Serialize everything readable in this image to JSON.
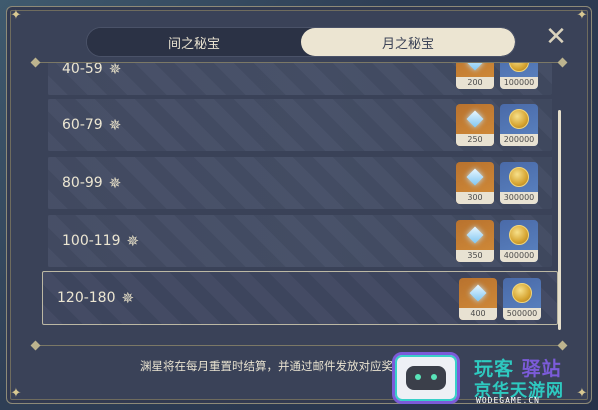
{
  "tabs": [
    {
      "label": "间之秘宝",
      "active": false
    },
    {
      "label": "月之秘宝",
      "active": true
    }
  ],
  "close_icon": "close-x-icon",
  "colors": {
    "accent_gold": "#d9c992",
    "panel": "#3a4258",
    "active_tab": "#ece5d2",
    "gem_bg": "#c8802f",
    "coin_bg": "#5378b8"
  },
  "rows": [
    {
      "label": "40-59",
      "gem_qty": "200",
      "coin_qty": "100000"
    },
    {
      "label": "60-79",
      "gem_qty": "250",
      "coin_qty": "200000"
    },
    {
      "label": "80-99",
      "gem_qty": "300",
      "coin_qty": "300000"
    },
    {
      "label": "100-119",
      "gem_qty": "350",
      "coin_qty": "400000"
    },
    {
      "label": "120-180",
      "gem_qty": "400",
      "coin_qty": "500000",
      "selected": true
    }
  ],
  "star_icon": "abyss-star-icon",
  "footer_note": "渊星将在每月重置时结算，并通过邮件发放对应奖励",
  "watermark": {
    "line1_a": "玩客",
    "line1_b": "驿站",
    "line2": "京华天游网",
    "line3": "WODEGAME.CN"
  }
}
